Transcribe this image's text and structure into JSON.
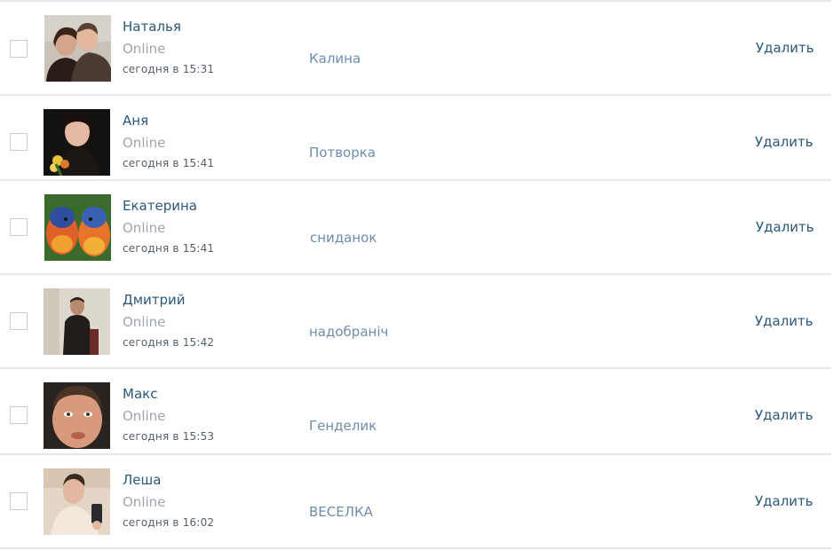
{
  "friends": [
    {
      "name": "Наталья",
      "status": "Online",
      "last_seen": "сегодня в 15:31",
      "list": "Калина",
      "action": "Удалить",
      "avatar": "couple-photo"
    },
    {
      "name": "Аня",
      "status": "Online",
      "last_seen": "сегодня в 15:41",
      "list": "Потворка",
      "action": "Удалить",
      "avatar": "woman-with-flowers-photo"
    },
    {
      "name": "Екатерина",
      "status": "Online",
      "last_seen": "сегодня в 15:41",
      "list": "сниданок",
      "action": "Удалить",
      "avatar": "parrots-photo"
    },
    {
      "name": "Дмитрий",
      "status": "Online",
      "last_seen": "сегодня в 15:42",
      "list": "надобраніч",
      "action": "Удалить",
      "avatar": "man-standing-photo"
    },
    {
      "name": "Макс",
      "status": "Online",
      "last_seen": "сегодня в 15:53",
      "list": "Генделик",
      "action": "Удалить",
      "avatar": "man-face-closeup-photo"
    },
    {
      "name": "Леша",
      "status": "Online",
      "last_seen": "сегодня в 16:02",
      "list": "ВЕСЕЛКА",
      "action": "Удалить",
      "avatar": "man-mirror-selfie-photo"
    }
  ]
}
